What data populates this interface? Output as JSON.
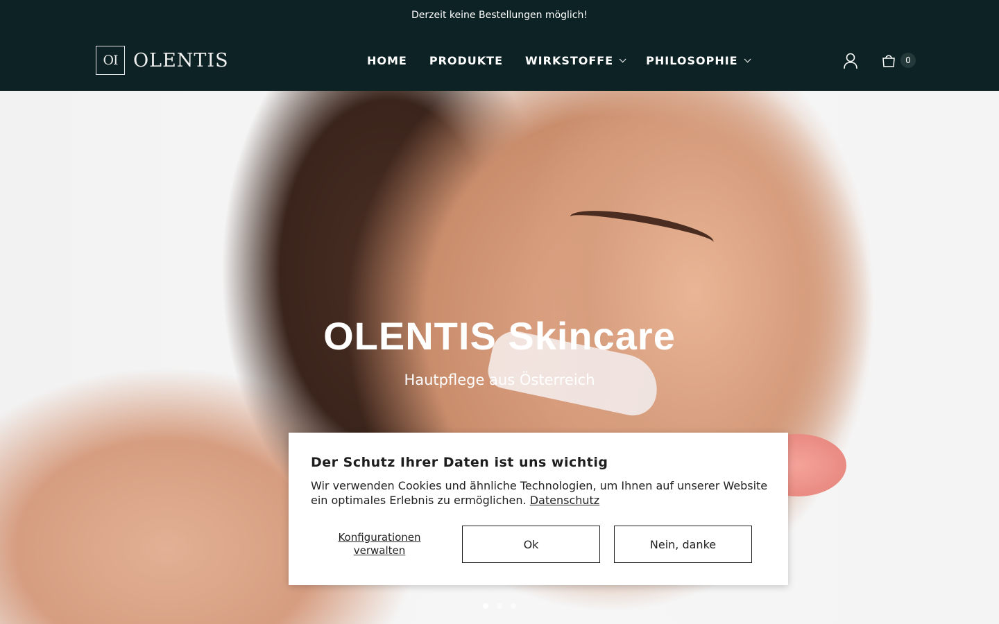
{
  "announcement": {
    "text": "Derzeit keine Bestellungen möglich!"
  },
  "header": {
    "logo_mark": "OI",
    "logo_text": "OLENTIS",
    "nav": [
      {
        "label": "HOME",
        "dropdown": false
      },
      {
        "label": "PRODUKTE",
        "dropdown": false
      },
      {
        "label": "WIRKSTOFFE",
        "dropdown": true
      },
      {
        "label": "PHILOSOPHIE",
        "dropdown": true
      }
    ],
    "account_icon": "user-icon",
    "cart_icon": "shopping-bag-icon",
    "cart_count": "0"
  },
  "hero": {
    "title": "OLENTIS Skincare",
    "subtitle": "Hautpflege aus Österreich",
    "slides_total": 3,
    "active_slide": 1
  },
  "cookie_banner": {
    "title": "Der Schutz Ihrer Daten ist uns wichtig",
    "text": "Wir verwenden Cookies und ähnliche Technologien, um Ihnen auf unserer Website ein optimales Erlebnis zu ermöglichen.",
    "privacy_link": "Datenschutz",
    "manage_label": "Konfigurationen verwalten",
    "ok_label": "Ok",
    "decline_label": "Nein, danke"
  },
  "colors": {
    "header_bg": "#0d2224",
    "text_light": "#ffffff"
  }
}
